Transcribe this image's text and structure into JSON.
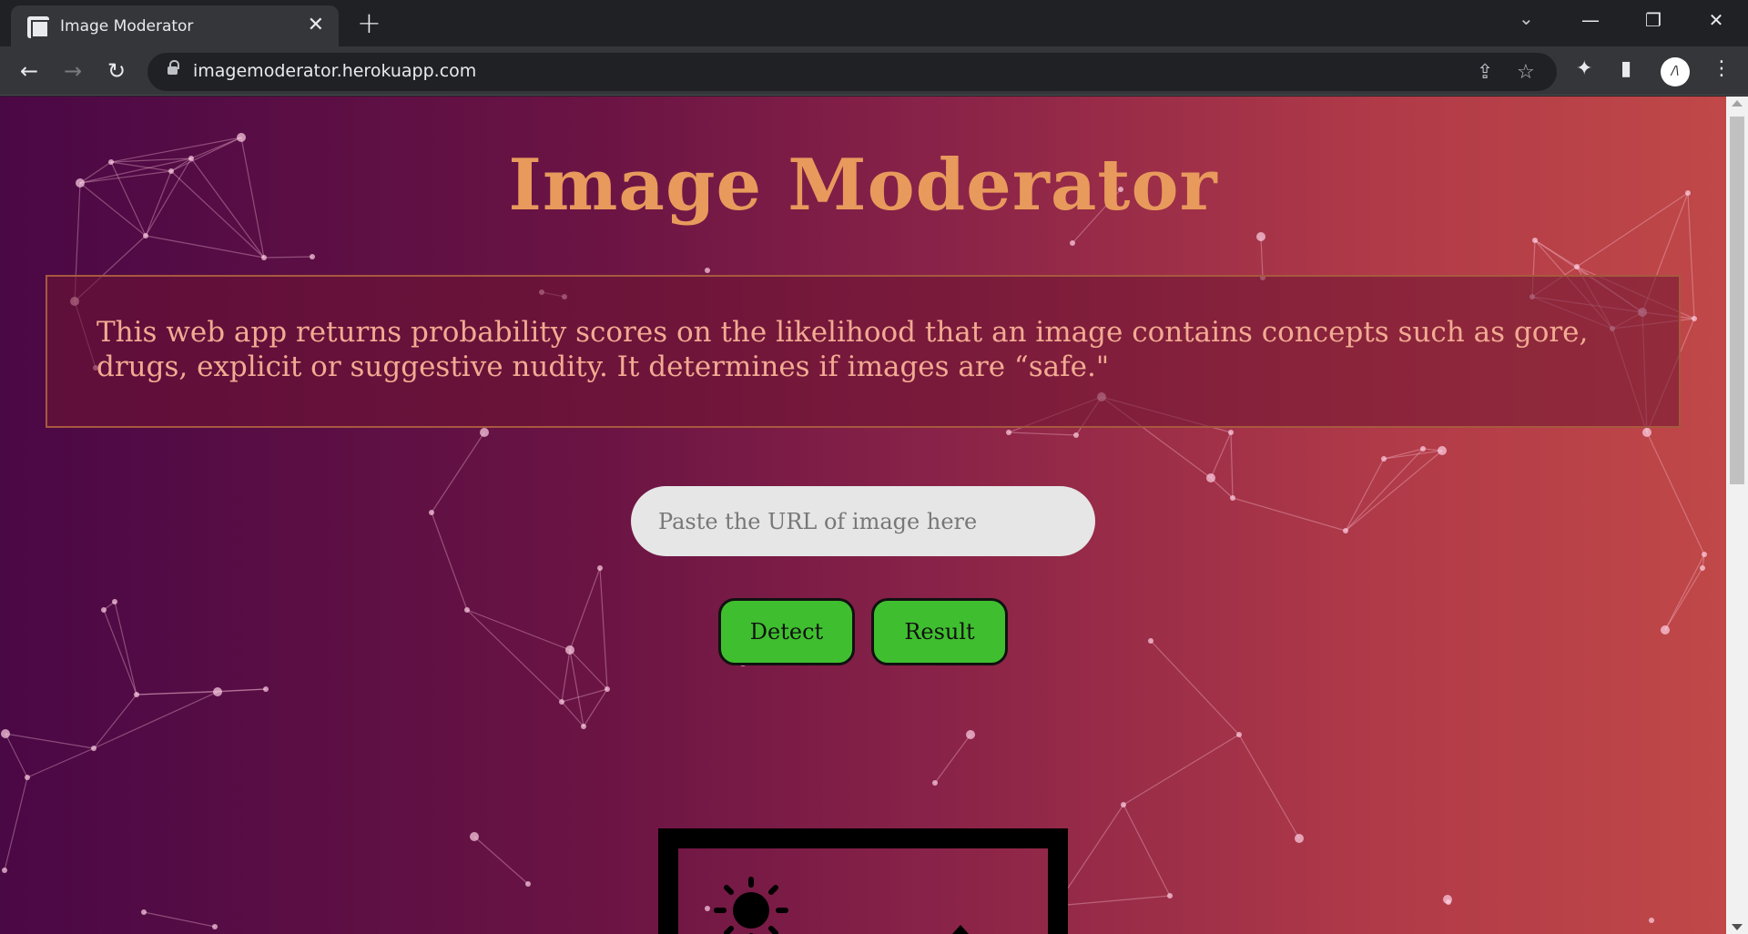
{
  "browser": {
    "tab_title": "Image Moderator",
    "tab_close": "✕",
    "new_tab": "+",
    "tab_search": "⌄",
    "url": "imagemoderator.herokuapp.com",
    "profile_initial": "/\\",
    "window": {
      "minimize": "—",
      "restore": "❐",
      "close": "✕"
    },
    "nav": {
      "back": "←",
      "forward": "→",
      "reload": "↻"
    },
    "icons": {
      "share": "⇪",
      "bookmark": "☆",
      "extensions": "✦",
      "sidepanel": "▮"
    }
  },
  "page": {
    "title": "Image Moderator",
    "description": "This web app returns probability scores on the likelihood that an image contains concepts such as gore, drugs, explicit or suggestive nudity. It determines if images are “safe.\"",
    "input_placeholder": "Paste the URL of image here",
    "detect_label": "Detect",
    "result_label": "Result"
  },
  "colors": {
    "title": "#e89a5c",
    "description": "#f2aa92",
    "button": "#3fbf2f",
    "gradient_start": "#4a0845",
    "gradient_end": "#c04848"
  }
}
